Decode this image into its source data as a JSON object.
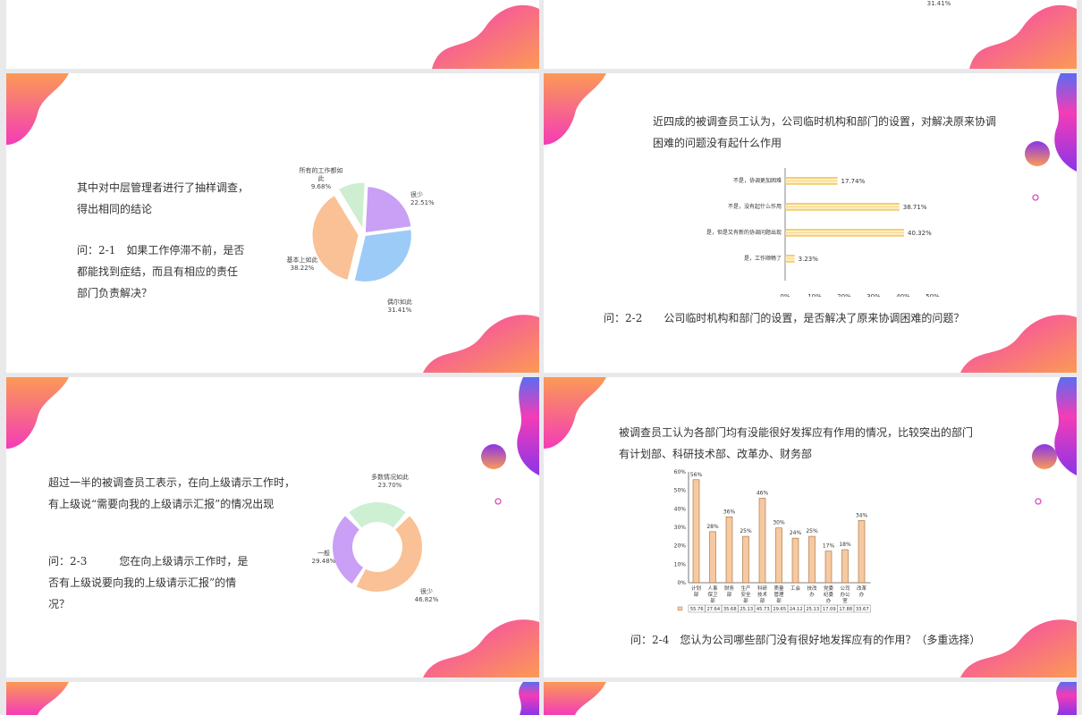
{
  "colors": {
    "pink": "#f43cb7",
    "orange": "#fb9a55",
    "purple": "#8a35e8",
    "blue": "#5b6cf0"
  },
  "slide_top_right": {
    "stray_label": "31.41%"
  },
  "slide_1": {
    "intro": "其中对中层管理者进行了抽样调查，得出相同的结论",
    "question": "问：2-1　如果工作停滞不前，是否都能找到症结，而且有相应的责任部门负责解决？",
    "chart_data": {
      "type": "pie",
      "labels": [
        "很少",
        "偶尔如此",
        "基本上如此",
        "所有的工作都如此"
      ],
      "values": [
        22.51,
        31.41,
        38.22,
        9.68
      ],
      "value_labels": [
        "22.51%",
        "31.41%",
        "38.22%",
        "9.68%"
      ],
      "colors": [
        "#c9a0f5",
        "#9dcbf8",
        "#f9c195",
        "#cdefd0"
      ]
    }
  },
  "slide_2": {
    "intro": "近四成的被调查员工认为，公司临时机构和部门的设置，对解决原来协调困难的问题没有起什么作用",
    "question": "问：2-2　　公司临时机构和部门的设置，是否解决了原来协调困难的问题？",
    "chart_data": {
      "type": "bar",
      "orientation": "horizontal",
      "categories": [
        "不是，协调更加困难",
        "不是，没有起什么作用",
        "是，但是又有新的协调问题出现",
        "是，工作顺畅了"
      ],
      "values": [
        17.74,
        38.71,
        40.32,
        3.23
      ],
      "value_labels": [
        "17.74%",
        "38.71%",
        "40.32%",
        "3.23%"
      ],
      "xticks": [
        "0%",
        "10%",
        "20%",
        "30%",
        "40%",
        "50%"
      ],
      "xlim": [
        0,
        50
      ]
    }
  },
  "slide_3": {
    "intro": "超过一半的被调查员工表示，在向上级请示工作时，有上级说“需要向我的上级请示汇报”的情况出现",
    "question": "问：2-3　　　您在向上级请示工作时，是否有上级说要向我的上级请示汇报”的情况？",
    "chart_data": {
      "type": "pie",
      "variant": "doughnut",
      "labels": [
        "多数情况如此",
        "很少",
        "一般"
      ],
      "values": [
        23.7,
        46.82,
        29.48
      ],
      "value_labels": [
        "23.70%",
        "46.82%",
        "29.48%"
      ],
      "colors": [
        "#cdf0d2",
        "#f9c195",
        "#c9a0f5"
      ]
    }
  },
  "slide_4": {
    "intro": "被调查员工认为各部门均有没能很好发挥应有作用的情况，比较突出的部门有计划部、科研技术部、改革办、财务部",
    "question": "问：2-4　您认为公司哪些部门没有很好地发挥应有的作用？（多重选择）",
    "chart_data": {
      "type": "bar",
      "orientation": "vertical",
      "categories": [
        "计划部",
        "人事保卫部",
        "财务部",
        "生产安全部",
        "科研技术部",
        "质量管理部",
        "工会",
        "技改办",
        "党委纪委办",
        "公司办公室",
        "改革办"
      ],
      "values": [
        55.76,
        27.64,
        35.68,
        25.13,
        45.73,
        29.65,
        24.12,
        25.13,
        17.09,
        17.88,
        33.67
      ],
      "value_labels": [
        "56%",
        "28%",
        "36%",
        "25%",
        "46%",
        "30%",
        "24%",
        "25%",
        "17%",
        "18%",
        "34%"
      ],
      "table_values": [
        "55.76",
        "27.64",
        "35.68",
        "25.13",
        "45.73",
        "29.65",
        "24.12",
        "25.13",
        "17.09",
        "17.88",
        "33.67"
      ],
      "yticks": [
        "0%",
        "10%",
        "20%",
        "30%",
        "40%",
        "50%",
        "60%"
      ],
      "ylim": [
        0,
        60
      ]
    }
  }
}
